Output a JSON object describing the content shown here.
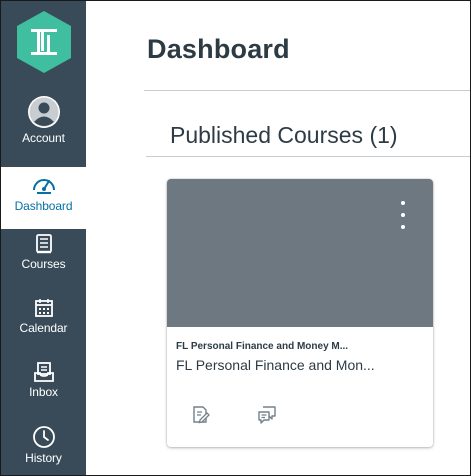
{
  "nav": {
    "items": [
      {
        "id": "account",
        "label": "Account",
        "icon": "account-icon"
      },
      {
        "id": "dashboard",
        "label": "Dashboard",
        "icon": "dashboard-icon",
        "active": true
      },
      {
        "id": "courses",
        "label": "Courses",
        "icon": "courses-icon"
      },
      {
        "id": "calendar",
        "label": "Calendar",
        "icon": "calendar-icon"
      },
      {
        "id": "inbox",
        "label": "Inbox",
        "icon": "inbox-icon"
      },
      {
        "id": "history",
        "label": "History",
        "icon": "history-icon"
      }
    ],
    "logo_icon": "institution-logo",
    "background_color": "#394b58",
    "active_color": "#0770a3",
    "logo_color": "#3fbfa0"
  },
  "page": {
    "title": "Dashboard",
    "section_title": "Published Courses (1)"
  },
  "courses": [
    {
      "title": "FL Personal Finance and Money M...",
      "subtitle": "FL Personal Finance and Mon...",
      "hero_color": "#6e7881",
      "menu_icon": "kebab-menu-icon",
      "action_icons": [
        "assignments-icon",
        "discussions-icon"
      ]
    }
  ]
}
